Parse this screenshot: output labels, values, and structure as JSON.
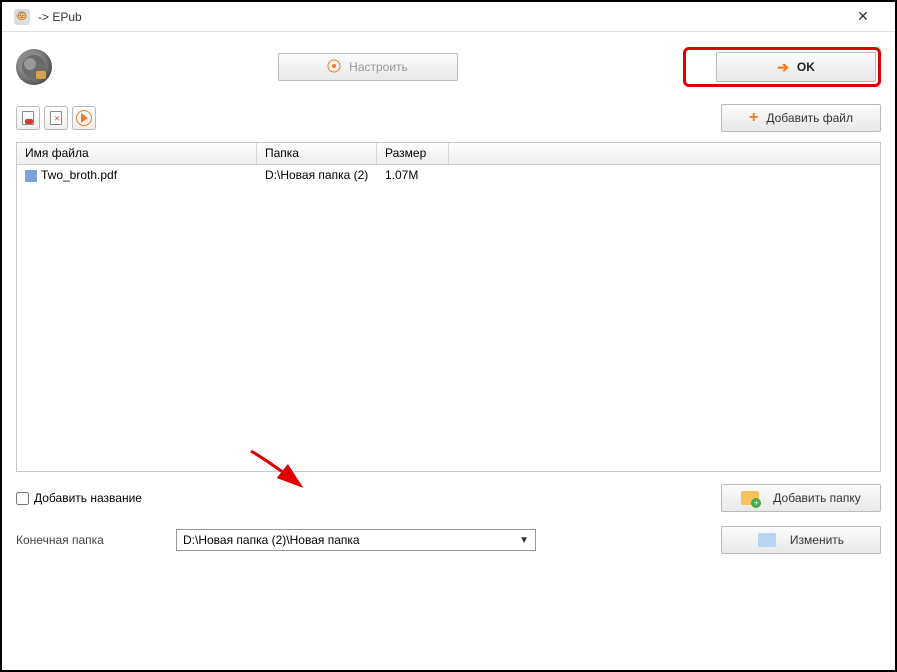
{
  "titlebar": {
    "title": "-> EPub"
  },
  "toolbar": {
    "settings_label": "Настроить",
    "ok_label": "OK",
    "addfile_label": "Добавить файл"
  },
  "table": {
    "headers": {
      "filename": "Имя файла",
      "folder": "Папка",
      "size": "Размер"
    },
    "rows": [
      {
        "filename": "Two_broth.pdf",
        "folder": "D:\\Новая папка (2)",
        "size": "1.07M"
      }
    ]
  },
  "options": {
    "add_title_label": "Добавить название",
    "add_folder_label": "Добавить папку",
    "change_label": "Изменить"
  },
  "dest": {
    "label": "Конечная папка",
    "value": "D:\\Новая папка (2)\\Новая папка"
  }
}
